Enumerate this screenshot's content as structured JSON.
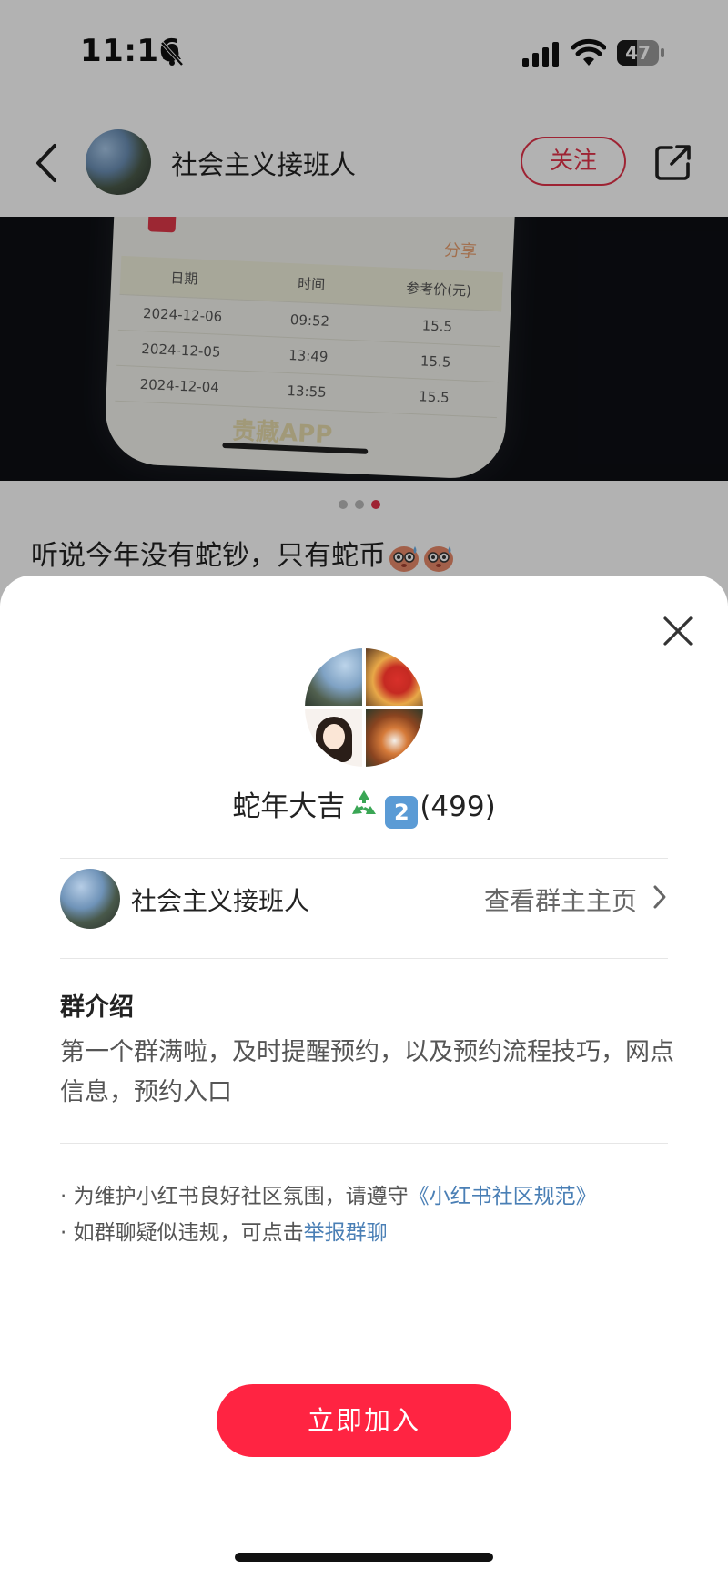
{
  "status_bar": {
    "time": "11:16",
    "battery": "47",
    "battery_level": 0.47,
    "icons": [
      "bell-slash-icon",
      "signal-icon",
      "wifi-icon",
      "battery-icon"
    ]
  },
  "nav": {
    "author_name": "社会主义接班人",
    "follow_label": "关注",
    "icons": [
      "back-icon",
      "share-icon"
    ]
  },
  "photo": {
    "share_label": "分享",
    "table": {
      "headers": [
        "日期",
        "时间",
        "参考价(元)"
      ],
      "rows": [
        [
          "2024-12-06",
          "09:52",
          "15.5"
        ],
        [
          "2024-12-05",
          "13:49",
          "15.5"
        ],
        [
          "2024-12-04",
          "13:55",
          "15.5"
        ]
      ]
    },
    "watermark": "贵藏APP",
    "pager": {
      "count": 3,
      "active": 2
    }
  },
  "post": {
    "caption": "听说今年没有蛇钞，只有蛇币"
  },
  "sheet": {
    "group_name_prefix": "蛇年大吉",
    "group_badge": "2",
    "group_count": "(499)",
    "owner_name": "社会主义接班人",
    "owner_link": "查看群主主页",
    "intro_title": "群介绍",
    "intro_text": "第一个群满啦，及时提醒预约，以及预约流程技巧，网点信息，预约入口",
    "notice1_text": "· 为维护小红书良好社区氛围，请遵守",
    "notice1_link": "《小红书社区规范》",
    "notice2_text": "· 如群聊疑似违规，可点击",
    "notice2_link": "举报群聊",
    "join_label": "立即加入",
    "colors": {
      "accent": "#ff2442",
      "link": "#4a7fb5"
    }
  }
}
